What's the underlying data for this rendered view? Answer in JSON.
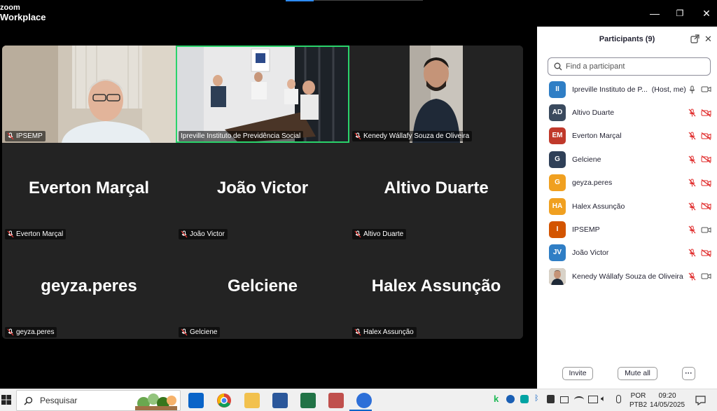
{
  "app": {
    "brand_top": "zoom",
    "brand_bottom": "Workplace"
  },
  "window_controls": {
    "minimize": "—",
    "restore": "❐",
    "close": "✕"
  },
  "gallery": {
    "tiles": [
      {
        "label": "IPSEMP",
        "type": "video",
        "active": false
      },
      {
        "label": "Ipreville Instituto de Previdência Social",
        "type": "video",
        "active": true
      },
      {
        "label": "Kenedy Wállafy Souza de Oliveira",
        "type": "video",
        "active": false
      },
      {
        "name": "Everton Marçal",
        "label": "Everton Marçal",
        "type": "name"
      },
      {
        "name": "João Victor",
        "label": "João Victor",
        "type": "name"
      },
      {
        "name": "Altivo Duarte",
        "label": "Altivo Duarte",
        "type": "name"
      },
      {
        "name": "geyza.peres",
        "label": "geyza.peres",
        "type": "name"
      },
      {
        "name": "Gelciene",
        "label": "Gelciene",
        "type": "name"
      },
      {
        "name": "Halex Assunção",
        "label": "Halex Assunção",
        "type": "name"
      }
    ]
  },
  "participants_panel": {
    "title": "Participants (9)",
    "search_placeholder": "Find a participant",
    "participants": [
      {
        "initials": "II",
        "name": "Ipreville Instituto de P...",
        "role": "(Host, me)",
        "color": "#2f7ec5",
        "muted": false,
        "video_off": false
      },
      {
        "initials": "AD",
        "name": "Altivo Duarte",
        "role": "",
        "color": "#3a4a5e",
        "muted": true,
        "video_off": true
      },
      {
        "initials": "EM",
        "name": "Everton Marçal",
        "role": "",
        "color": "#c0392b",
        "muted": true,
        "video_off": true
      },
      {
        "initials": "G",
        "name": "Gelciene",
        "role": "",
        "color": "#2f4058",
        "muted": true,
        "video_off": true
      },
      {
        "initials": "G",
        "name": "geyza.peres",
        "role": "",
        "color": "#f0a020",
        "muted": true,
        "video_off": true
      },
      {
        "initials": "HA",
        "name": "Halex Assunção",
        "role": "",
        "color": "#f0a020",
        "muted": true,
        "video_off": true
      },
      {
        "initials": "I",
        "name": "IPSEMP",
        "role": "",
        "color": "#d35400",
        "muted": true,
        "video_off": false
      },
      {
        "initials": "JV",
        "name": "João Victor",
        "role": "",
        "color": "#2f7ec5",
        "muted": true,
        "video_off": true
      },
      {
        "initials": "",
        "name": "Kenedy Wállafy Souza de Oliveira",
        "role": "",
        "color": "#7a5a40",
        "muted": true,
        "video_off": false
      }
    ],
    "invite_label": "Invite",
    "mute_all_label": "Mute all",
    "more_label": "···"
  },
  "taskbar": {
    "search_label": "Pesquisar",
    "lang_top": "POR",
    "lang_bottom": "PTB2",
    "time": "09:20",
    "date": "14/05/2025"
  }
}
